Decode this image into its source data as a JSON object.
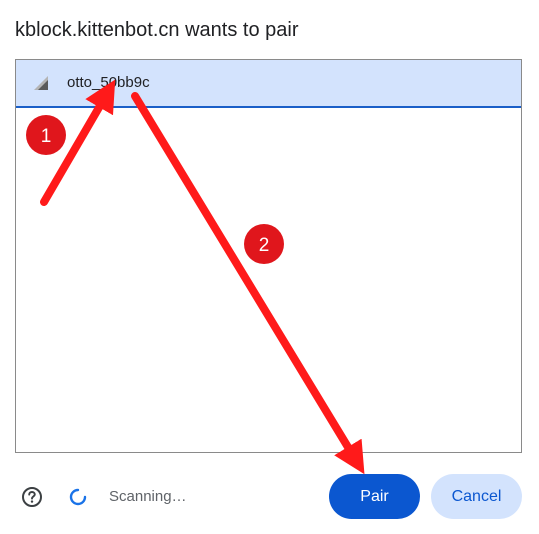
{
  "dialog": {
    "title": "kblock.kittenbot.cn wants to pair"
  },
  "devices": [
    {
      "name": "otto_50bb9c",
      "icon": "signal-strength-icon",
      "selected": true
    }
  ],
  "footer": {
    "help_icon": "help-circle-icon",
    "spinner_icon": "loading-spinner-icon",
    "status": "Scanning…",
    "pair_label": "Pair",
    "cancel_label": "Cancel"
  },
  "annotations": {
    "step1_label": "1",
    "step2_label": "2",
    "arrow_color": "#ff1a1a",
    "badge_color": "#e0161c"
  },
  "colors": {
    "selected_row": "#d3e3fd",
    "accent": "#0b57d0"
  }
}
